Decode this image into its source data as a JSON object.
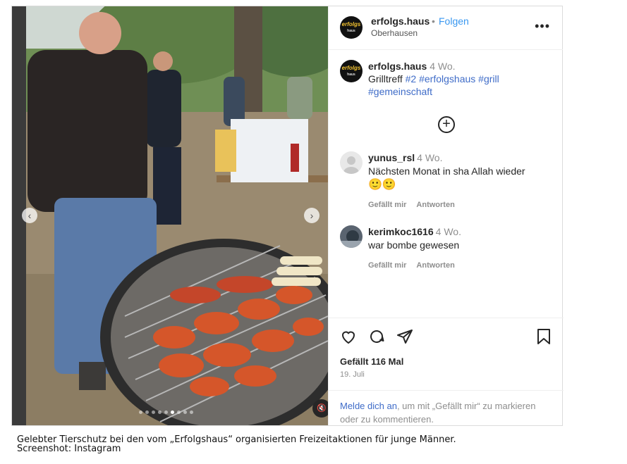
{
  "post": {
    "username": "erfolgs.haus",
    "separator": "•",
    "follow_label": "Folgen",
    "location": "Oberhausen",
    "more_icon": "more-icon",
    "avatar_text_top": "erfolgs",
    "avatar_text_bottom": "haus"
  },
  "caption": {
    "username": "erfolgs.haus",
    "time": "4 Wo.",
    "text": "Grilltreff",
    "hashtag_num": "#2",
    "hashtags": "#erfolgshaus #grill #gemeinschaft"
  },
  "comments": [
    {
      "username": "yunus_rsl",
      "time": "4 Wo.",
      "text": "Nächsten Monat in sha Allah wieder",
      "emoji": "🙂🙂",
      "like_label": "Gefällt mir",
      "reply_label": "Antworten"
    },
    {
      "username": "kerimkoc1616",
      "time": "4 Wo.",
      "text": "war bombe gewesen",
      "like_label": "Gefällt mir",
      "reply_label": "Antworten"
    }
  ],
  "actions": {
    "likes": "Gefällt 116 Mal",
    "date": "19. Juli",
    "icons": [
      "heart-icon",
      "comment-icon",
      "share-icon",
      "bookmark-icon"
    ]
  },
  "login_prompt": {
    "link": "Melde dich an",
    "text": ", um mit „Gefällt mir“ zu markieren oder zu kommentieren."
  },
  "figure_caption": {
    "line1": "Gelebter Tierschutz bei den vom „Erfolgshaus“ organisierten Freizeitaktionen für junge Männer.",
    "line2": "Screenshot: Instagram"
  },
  "colors": {
    "link_blue": "#3f6cc8",
    "follow_blue": "#3897f0",
    "muted": "#8e8e8e",
    "border": "#dbdbdb"
  }
}
